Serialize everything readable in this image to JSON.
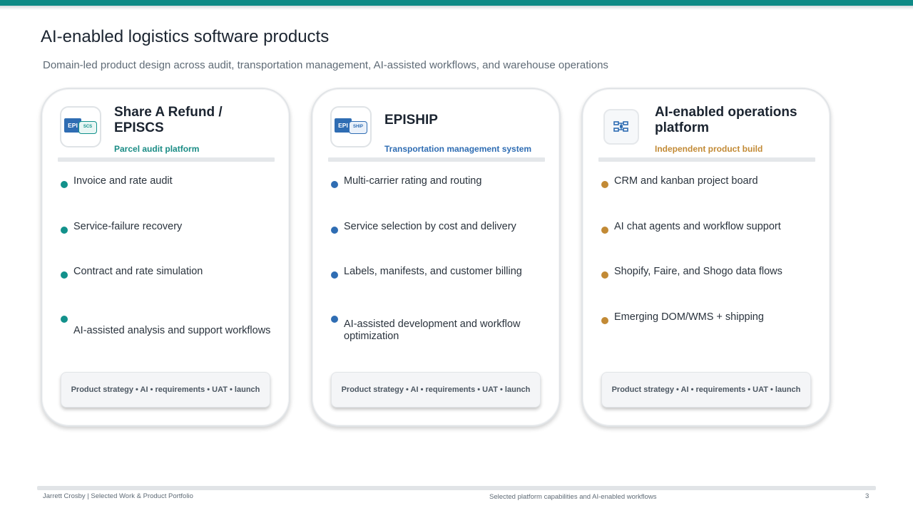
{
  "page": {
    "title": "AI-enabled logistics software products",
    "subtitle": "Domain-led product design across audit, transportation management, AI-assisted workflows, and warehouse operations"
  },
  "colors": {
    "accent_teal": "#0e8a86",
    "accent_blue": "#2f6db3",
    "accent_gold": "#c28a35"
  },
  "cards": [
    {
      "logo": {
        "main": "EPI",
        "sub": "SCS",
        "icon": "epi-scs-logo-icon"
      },
      "title_line1": "Share A Refund /",
      "title_line2": "EPISCS",
      "tag": "Parcel audit platform",
      "items": [
        "Invoice and rate audit",
        "Service-failure recovery",
        "Contract and rate simulation",
        "AI-assisted analysis and support workflows"
      ],
      "pill": "Product strategy • AI • requirements • UAT • launch"
    },
    {
      "logo": {
        "main": "EPI",
        "sub": "SHIP",
        "icon": "epi-ship-logo-icon"
      },
      "title_line1": "EPISHIP",
      "title_line2": "",
      "tag": "Transportation management system",
      "items": [
        "Multi-carrier rating and routing",
        "Service selection by cost and delivery",
        "Labels, manifests, and customer billing",
        "AI-assisted development and workflow optimization"
      ],
      "pill": "Product strategy • AI • requirements • UAT • launch"
    },
    {
      "logo": {
        "icon": "workflow-diagram-icon"
      },
      "title_line1": "AI-enabled operations",
      "title_line2": "platform",
      "tag": "Independent product build",
      "items": [
        "CRM and kanban project board",
        "AI chat agents and workflow support",
        "Shopify, Faire, and Shogo data flows",
        "Emerging DOM/WMS + shipping"
      ],
      "pill": "Product strategy • AI • requirements • UAT • launch"
    }
  ],
  "footer": {
    "left": "Jarrett Crosby | Selected Work & Product Portfolio",
    "center": "Selected platform capabilities and AI-enabled workflows",
    "page_number": "3"
  }
}
